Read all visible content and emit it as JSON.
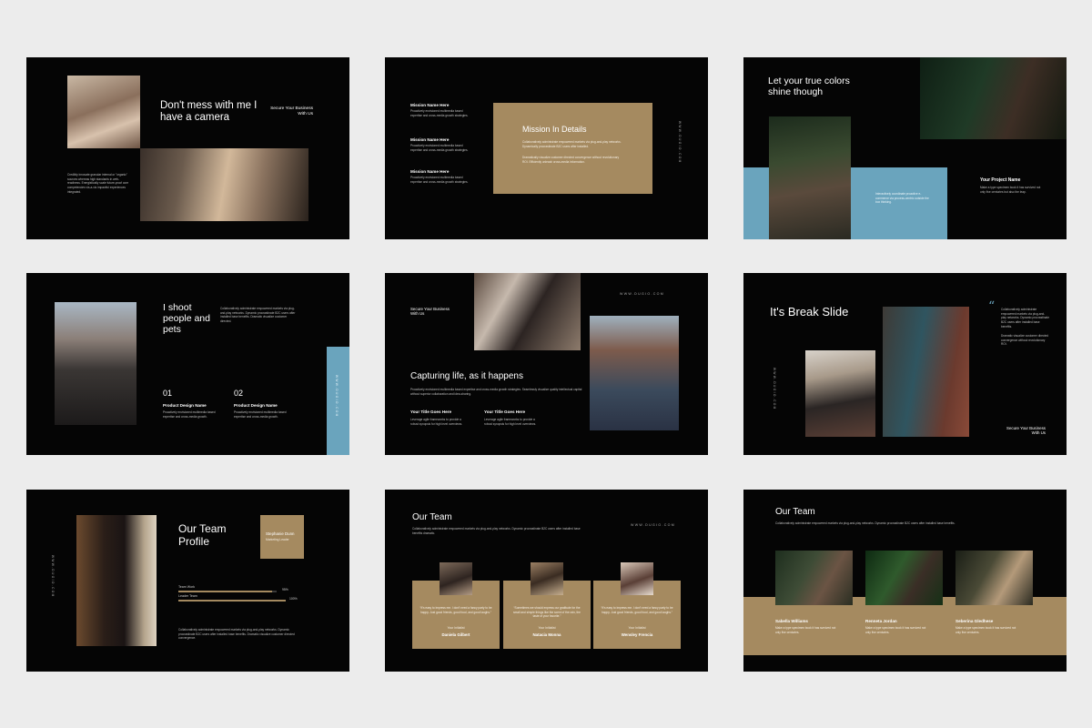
{
  "colors": {
    "gold": "#a58a60",
    "blue": "#6aa4bd",
    "slide_bg": "#050505",
    "page_bg": "#ececec"
  },
  "slides": {
    "s1": {
      "title": "Don't mess with me I have a camera",
      "tag": "Secure Your Business With Us",
      "body": "Credibly innovate granular internal or \"organic\" sources whereas high standards in web-readiness. Energistically scale future-proof core competencies vis-a-vis impactful experiences integrated."
    },
    "s2": {
      "items": [
        {
          "title": "Mission Name Here",
          "text": "Proactively envisioned multimedia based expertise and cross-media growth strategies."
        },
        {
          "title": "Mission Name Here",
          "text": "Proactively envisioned multimedia based expertise and cross-media growth strategies."
        },
        {
          "title": "Mission Name Here",
          "text": "Proactively envisioned multimedia based expertise and cross-media growth strategies."
        }
      ],
      "box_title": "Mission In Details",
      "box_p1": "Collaboratively administrate empowered markets via plug-and-play networks. Dynamically procrastinate B2C users after installed.",
      "box_p2": "Dramatically visualize customer directed convergence without revolutionary ROI. Efficiently unleash cross-media information.",
      "vert": "WWW.DUGIO.COM"
    },
    "s3": {
      "title": "Let your true colors shine though",
      "proj_title": "Your Project Name",
      "proj_text": "Make a type specimen book it has survived not only five centuries but also the leap.",
      "blue_text": "Interactively coordinate proactive e-commerce via process-centric outside the box thinking."
    },
    "s4": {
      "title": "I shoot people and pets",
      "body": "Collaboratively administrate empowered markets via plug-and-play networks. Dynamic procrastinate B2C users after installed base benefits. Dramatic visualize customer directed.",
      "n1": "01",
      "n2": "02",
      "h1": "Product Design Name",
      "h2": "Product Design Name",
      "p1": "Proactively envisioned multimedia based expertise and cross-media growth.",
      "p2": "Proactively envisioned multimedia based expertise and cross-media growth.",
      "vert": "WWW.DUGIO.COM"
    },
    "s5": {
      "tag": "Secure Your Business With Us",
      "url": "WWW.DUGIO.COM",
      "title": "Capturing life, as it happens",
      "body": "Proactively envisioned multimedia based expertise and cross-media growth strategies. Seamlessly visualize quality intellectual capital without superior collaboration and idea-sharing.",
      "h1": "Your Title Goes Here",
      "h2": "Your Title Goes Here",
      "p1": "Leverage agile frameworks to provide a robust synopsis for high level overviews.",
      "p2": "Leverage agile frameworks to provide a robust synopsis for high level overviews."
    },
    "s6": {
      "title": "It's Break Slide",
      "quote": "“",
      "body1": "Collaboratively administrate empowered markets via plug-and-play networks. Dynamic procrastinate B2C users after installed base benefits.",
      "body2": "Dramatic visualize customer directed convergence without revolutionary ROI.",
      "tag": "Secure Your Business With Us",
      "vert": "WWW.DUGIO.COM"
    },
    "s7": {
      "title": "Our Team Profile",
      "name": "Stephanie Dunn",
      "role": "Marketing Leader",
      "skills": [
        {
          "label": "Team Work",
          "pct": "95%",
          "value": 0.95
        },
        {
          "label": "Leader Team",
          "pct": "100%",
          "value": 1.0
        }
      ],
      "body": "Collaboratively administrate empowered markets via plug-and-play networks. Dynamic procrastinate B2C users after installed base benefits. Dramatic visualize customer directed convergence.",
      "vert": "WWW.DUGIO.COM"
    },
    "s8": {
      "title": "Our Team",
      "body": "Collaboratively administrate empowered markets via plug-and-play networks. Dynamic procrastinate B2C users after installed base benefits dramatic.",
      "url": "WWW.DUGIO.COM",
      "members": [
        {
          "quote": "“It's easy to impress me. I don't need a fancy party to be happy. Just good friends, good food, and good laughs.”",
          "label": "Your Initialist",
          "name": "Daniela Gilbert"
        },
        {
          "quote": "“Sometimes we should express our gratitude for the small and simple things like the scent of the rain, the taste of your favorite.”",
          "label": "Your Initialist",
          "name": "Natacia Monna"
        },
        {
          "quote": "“It's easy to impress me. I don't need a fancy party to be happy. Just good friends, good food, and good laughs.”",
          "label": "Your Initialist",
          "name": "Wensley Frencia"
        }
      ]
    },
    "s9": {
      "title": "Our Team",
      "body": "Collaboratively administrate empowered markets via plug-and-play networks. Dynamic procrastinate B2C users after installed base benefits.",
      "members": [
        {
          "name": "Sabella Williams",
          "text": "Make a type specimen book it has survived not only five centuries."
        },
        {
          "name": "Renneta Jordan",
          "text": "Make a type specimen book it has survived not only five centuries."
        },
        {
          "name": "Seberina Gledhese",
          "text": "Make a type specimen book it has survived not only five centuries."
        }
      ]
    }
  }
}
